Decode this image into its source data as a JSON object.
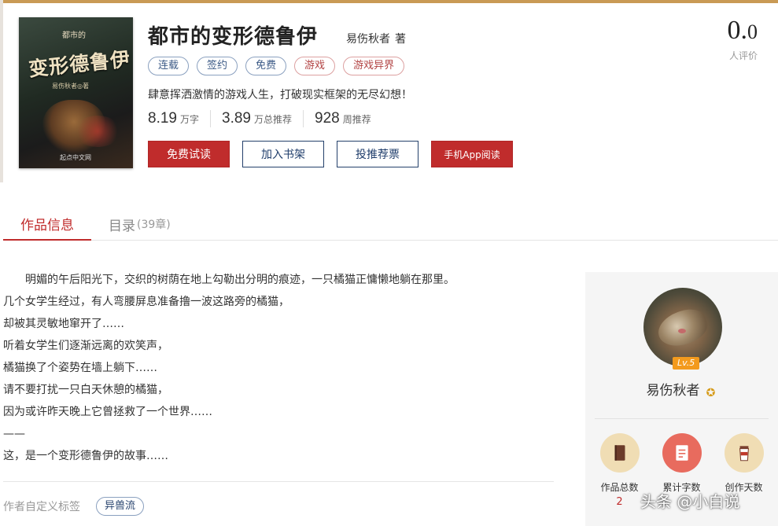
{
  "book": {
    "title": "都市的变形德鲁伊",
    "author": "易伤秋者",
    "author_suffix": "著",
    "cover": {
      "top_text": "都市的",
      "title_text": "变形德鲁伊",
      "author_text": "易伤秋者◎著",
      "publisher_text": "起点中文网"
    },
    "tags": [
      {
        "label": "连载",
        "style": "blue"
      },
      {
        "label": "签约",
        "style": "blue"
      },
      {
        "label": "免费",
        "style": "blue"
      },
      {
        "label": "游戏",
        "style": "red"
      },
      {
        "label": "游戏异界",
        "style": "red"
      }
    ],
    "slogan": "肆意挥洒激情的游戏人生，打破现实框架的无尽幻想！",
    "stats": [
      {
        "value": "8.19",
        "unit": "万字"
      },
      {
        "value": "3.89",
        "unit": "万总推荐"
      },
      {
        "value": "928",
        "unit": "周推荐"
      }
    ],
    "buttons": {
      "free_read": "免费试读",
      "add_shelf": "加入书架",
      "vote": "投推荐票",
      "app_read": "手机App阅读"
    },
    "rating": {
      "score_int": "0.",
      "score_dec": "0",
      "label": "人评价"
    }
  },
  "tabs": {
    "info": "作品信息",
    "toc": "目录",
    "toc_count": "(39章)"
  },
  "intro": {
    "lines": [
      "明媚的午后阳光下，交织的树荫在地上勾勒出分明的痕迹，一只橘猫正慵懒地躺在那里。",
      "几个女学生经过，有人弯腰屏息准备撸一波这路旁的橘猫，",
      "却被其灵敏地窜开了……",
      "听着女学生们逐渐远离的欢笑声，",
      "橘猫换了个姿势在墙上躺下……",
      "请不要打扰一只白天休憩的橘猫，",
      "因为或许昨天晚上它曾拯救了一个世界……",
      "——",
      "这，是一个变形德鲁伊的故事……"
    ],
    "custom_tags_label": "作者自定义标签",
    "custom_tags": [
      "异兽流"
    ]
  },
  "sidebar": {
    "level": "Lv.5",
    "name": "易伤秋者",
    "badge_icon": "star-badge-icon",
    "stats": [
      {
        "label": "作品总数",
        "value": "2",
        "icon": "book-icon"
      },
      {
        "label": "累计字数",
        "value": "",
        "icon": "document-icon"
      },
      {
        "label": "创作天数",
        "value": "",
        "icon": "coffee-cup-icon"
      }
    ]
  },
  "watermark": "头条 @小白说",
  "colors": {
    "accent_red": "#c02c2c",
    "navy": "#1f3d6b",
    "tag_blue": "#8aa0bf",
    "tag_red": "#dca0a0"
  }
}
